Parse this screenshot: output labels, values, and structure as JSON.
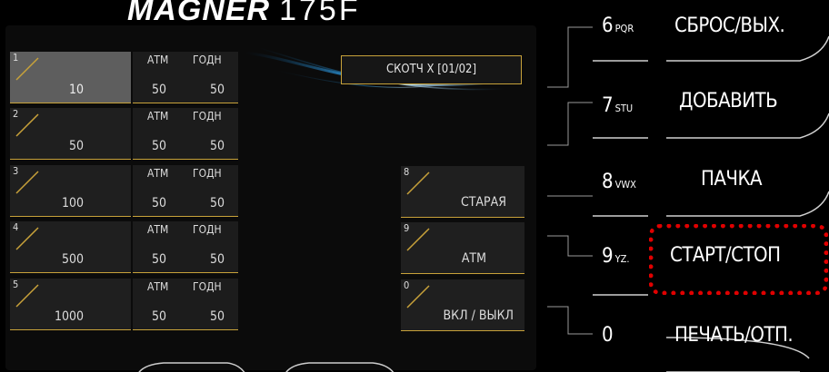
{
  "header": {
    "brand": "MAGNER",
    "model": "175F"
  },
  "denominations": [
    {
      "index": "1",
      "value": "10",
      "h1": "АТМ",
      "h2": "ГОДН",
      "c1": "50",
      "c2": "50",
      "active": true
    },
    {
      "index": "2",
      "value": "50",
      "h1": "АТМ",
      "h2": "ГОДН",
      "c1": "50",
      "c2": "50"
    },
    {
      "index": "3",
      "value": "100",
      "h1": "АТМ",
      "h2": "ГОДН",
      "c1": "50",
      "c2": "50"
    },
    {
      "index": "4",
      "value": "500",
      "h1": "АТМ",
      "h2": "ГОДН",
      "c1": "50",
      "c2": "50"
    },
    {
      "index": "5",
      "value": "1000",
      "h1": "АТМ",
      "h2": "ГОДН",
      "c1": "50",
      "c2": "50"
    }
  ],
  "info": {
    "tape": "СКОТЧ Х [01/02]"
  },
  "modes": [
    {
      "index": "8",
      "label": "СТАРАЯ"
    },
    {
      "index": "9",
      "label": "АТМ"
    },
    {
      "index": "0",
      "label": "ВКЛ / ВЫКЛ"
    }
  ],
  "keys": [
    {
      "digit": "6",
      "letters": "PQR",
      "function": "СБРОС/ВЫХ."
    },
    {
      "digit": "7",
      "letters": "STU",
      "function": "ДОБАВИТЬ"
    },
    {
      "digit": "8",
      "letters": "VWX",
      "function": "ПАЧКА"
    },
    {
      "digit": "9",
      "letters": "YZ.",
      "function": "СТАРТ/СТОП"
    },
    {
      "digit": "0",
      "letters": "",
      "function": "ПЕЧАТЬ/ОТП."
    }
  ],
  "highlight_color": "#e00000",
  "accent_color": "#c8a23a"
}
